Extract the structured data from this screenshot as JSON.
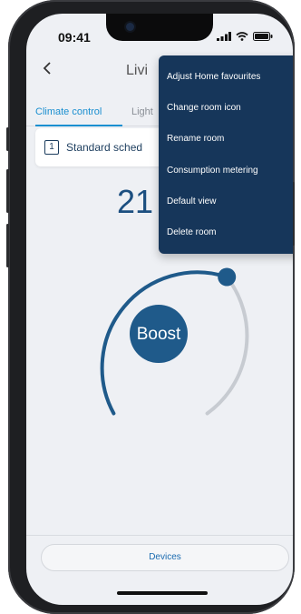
{
  "status_bar": {
    "time": "09:41"
  },
  "header": {
    "title": "Livi"
  },
  "tabs": [
    {
      "label": "Climate control"
    },
    {
      "label": "Light"
    }
  ],
  "schedule": {
    "number": "1",
    "label": "Standard sched"
  },
  "temperature": {
    "value": "21"
  },
  "boost": {
    "label": "Boost"
  },
  "menu": {
    "items": [
      {
        "label": "Adjust Home favourites"
      },
      {
        "label": "Change room icon"
      },
      {
        "label": "Rename room"
      },
      {
        "label": "Consumption metering"
      },
      {
        "label": "Default view"
      },
      {
        "label": "Delete room"
      }
    ]
  },
  "footer": {
    "devices_label": "Devices"
  },
  "colors": {
    "accent": "#1a8fd0",
    "menu_bg": "#16365a",
    "dial_active": "#1f5a8a",
    "dial_inactive": "#c7cbd1"
  }
}
